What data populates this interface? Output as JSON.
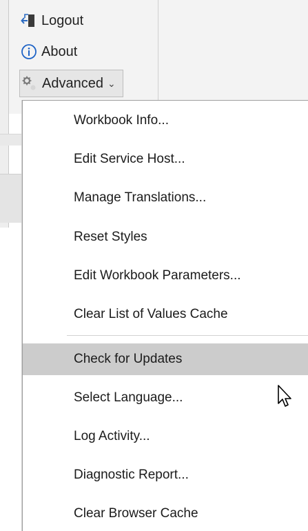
{
  "ribbon": {
    "logout_label": "Logout",
    "about_label": "About",
    "advanced_label": "Advanced",
    "advanced_chevron": "⌄"
  },
  "menu": {
    "items": [
      {
        "label": "Workbook Info..."
      },
      {
        "label": "Edit Service Host..."
      },
      {
        "label": "Manage Translations..."
      },
      {
        "label": "Reset Styles"
      },
      {
        "label": "Edit Workbook Parameters..."
      },
      {
        "label": "Clear List of Values Cache"
      },
      {
        "label": "Check for Updates",
        "hover": true
      },
      {
        "label": "Select Language..."
      },
      {
        "label": "Log Activity..."
      },
      {
        "label": "Diagnostic Report..."
      },
      {
        "label": "Clear Browser Cache"
      }
    ]
  },
  "colors": {
    "hover_bg": "#cccccc",
    "about_icon": "#1e63c6",
    "logout_icon": "#2b6bc2"
  },
  "icons": {
    "logout": "logout-icon",
    "about": "info-icon",
    "advanced": "gear-icon",
    "cursor": "arrow-cursor-icon"
  }
}
